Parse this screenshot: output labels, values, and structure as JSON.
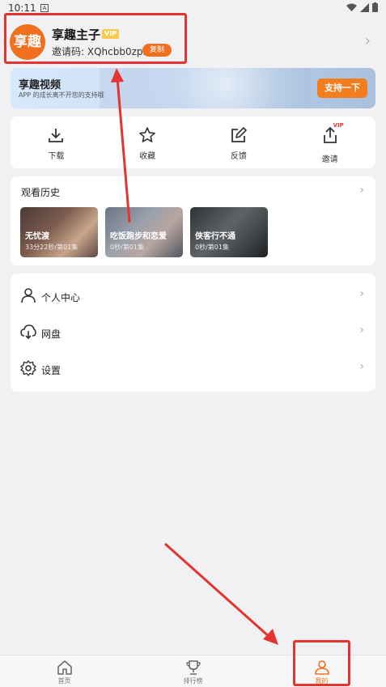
{
  "status_bar": {
    "time": "10:11",
    "notification_letter": "A"
  },
  "profile": {
    "avatar_text": "享趣",
    "username": "享趣主子",
    "vip_badge": "VIP",
    "invite_code_label": "邀请码: XQhcbb0zpr",
    "copy_label": "复制"
  },
  "banner": {
    "title": "享趣视频",
    "subtitle": "APP 的成长离不开您的支持哦",
    "button_label": "支持一下"
  },
  "actions": [
    {
      "label": "下载",
      "icon": "download-icon"
    },
    {
      "label": "收藏",
      "icon": "star-icon"
    },
    {
      "label": "反馈",
      "icon": "edit-icon"
    },
    {
      "label": "邀请",
      "icon": "share-icon",
      "tag": "VIP"
    }
  ],
  "history": {
    "title": "观看历史",
    "items": [
      {
        "title": "无忧渡",
        "progress": "33分22秒/第01集"
      },
      {
        "title": "吃饭跑步和恋爱",
        "progress": "0秒/第01集"
      },
      {
        "title": "侠客行不通",
        "progress": "0秒/第01集"
      }
    ]
  },
  "menu": [
    {
      "label": "个人中心",
      "icon": "person-icon"
    },
    {
      "label": "网盘",
      "icon": "cloud-download-icon"
    },
    {
      "label": "设置",
      "icon": "gear-icon"
    }
  ],
  "tabs": [
    {
      "label": "首页",
      "icon": "home-icon",
      "active": false
    },
    {
      "label": "排行榜",
      "icon": "trophy-icon",
      "active": false
    },
    {
      "label": "我的",
      "icon": "person-icon",
      "active": true
    }
  ],
  "colors": {
    "accent": "#f07020",
    "annotation": "#e3342f"
  }
}
